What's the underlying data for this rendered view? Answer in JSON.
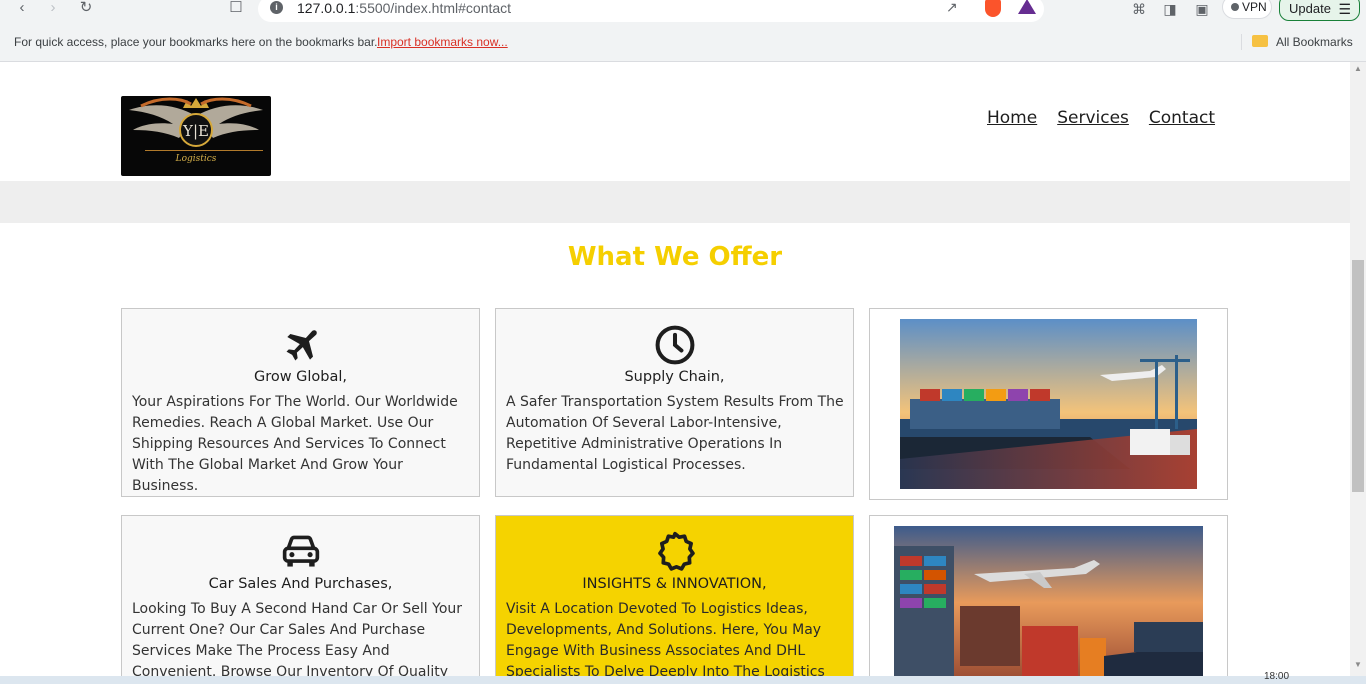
{
  "browser": {
    "url_host": "127.0.0.1",
    "url_path": ":5500/index.html#contact",
    "vpn_label": "VPN",
    "update_label": "Update",
    "bookmarks_prompt": "For quick access, place your bookmarks here on the bookmarks bar.",
    "import_link": "Import bookmarks now...",
    "all_bookmarks": "All Bookmarks"
  },
  "site": {
    "logo_initials": "Y|E",
    "logo_tagline": "Logistics",
    "nav": [
      "Home",
      "Services",
      "Contact"
    ]
  },
  "offer": {
    "title": "What We Offer",
    "accent_color": "#f5cf00",
    "cards": [
      {
        "icon": "airplane-icon",
        "title": "Grow Global,",
        "body": "Your Aspirations For The World. Our Worldwide Remedies. Reach A Global Market. Use Our Shipping Resources And Services To Connect With The Global Market And Grow Your Business."
      },
      {
        "icon": "clock-icon",
        "title": "Supply Chain,",
        "body": "A Safer Transportation System Results From The Automation Of Several Labor-Intensive, Repetitive Administrative Operations In Fundamental Logistical Processes."
      },
      {
        "icon": "car-icon",
        "title": "Car Sales And Purchases,",
        "body": "Looking To Buy A Second Hand Car Or Sell Your Current One? Our Car Sales And Purchase Services Make The Process Easy And Convenient. Browse Our Inventory Of Quality"
      },
      {
        "icon": "badge-icon",
        "title": "INSIGHTS & INNOVATION,",
        "body": "Visit A Location Devoted To Logistics Ideas, Developments, And Solutions. Here, You May Engage With Business Associates And DHL Specialists To Delve Deeply Into The Logistics"
      }
    ]
  },
  "taskbar": {
    "clock": "18:00"
  }
}
